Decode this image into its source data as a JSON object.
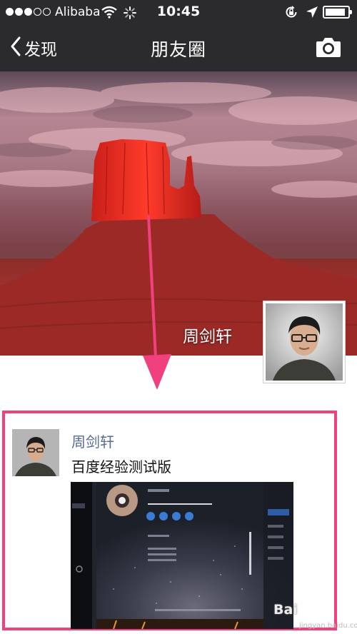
{
  "status_bar": {
    "signal_dots": [
      true,
      true,
      true,
      false,
      false
    ],
    "carrier": "Alibaba",
    "time": "10:45",
    "battery_level": 0.9,
    "icons": [
      "wifi-icon",
      "loading-spinner-icon",
      "rotation-lock-icon",
      "location-arrow-icon",
      "battery-icon"
    ]
  },
  "nav": {
    "back_label": "发现",
    "title": "朋友圈",
    "right_icon": "camera-icon"
  },
  "cover": {
    "user_name": "周剑轩",
    "background": "desert butte at sunset"
  },
  "moment": {
    "user_name": "周剑轩",
    "text": "百度经验测试版"
  },
  "watermark": {
    "brand": "Bai",
    "url": "jingyan.baidu.com"
  },
  "colors": {
    "nav_bg": "#2b2b2d",
    "name_link": "#576b95",
    "annotation": "#f0407d"
  }
}
